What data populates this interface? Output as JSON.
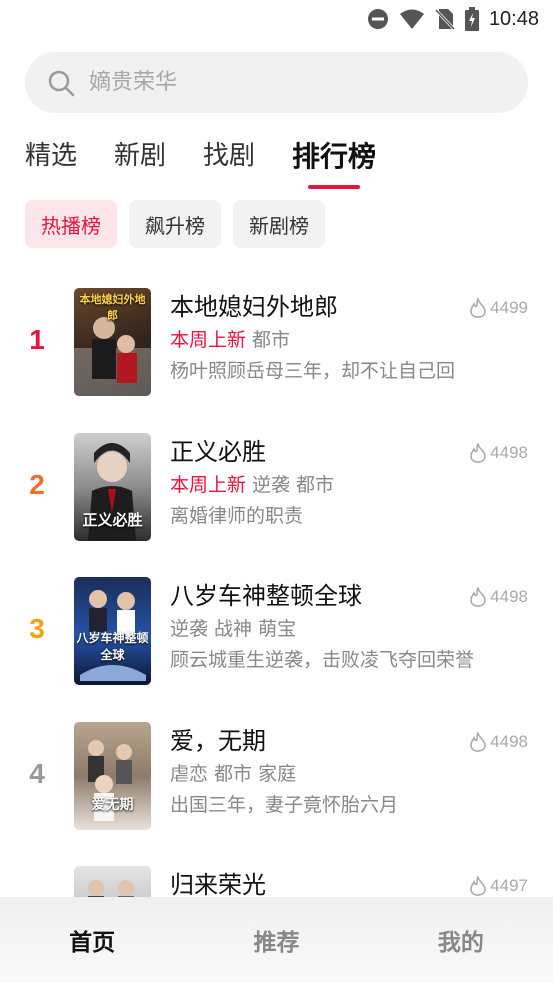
{
  "status_bar": {
    "time": "10:48"
  },
  "search": {
    "placeholder": "嫡贵荣华"
  },
  "tabs": [
    {
      "label": "精选"
    },
    {
      "label": "新剧"
    },
    {
      "label": "找剧"
    },
    {
      "label": "排行榜"
    }
  ],
  "chips": [
    {
      "label": "热播榜"
    },
    {
      "label": "飙升榜"
    },
    {
      "label": "新剧榜"
    }
  ],
  "list": [
    {
      "rank": "1",
      "rank_color": "#e8133f",
      "title": "本地媳妇外地郎",
      "new_tag": "本周上新",
      "tags": "都市",
      "desc": "杨叶照顾岳母三年，却不让自己回",
      "heat": "4499",
      "poster_text": "本地媳妇外地郎"
    },
    {
      "rank": "2",
      "rank_color": "#f26a2e",
      "title": "正义必胜",
      "new_tag": "本周上新",
      "tags": "逆袭 都市",
      "desc": "离婚律师的职责",
      "heat": "4498",
      "poster_text": "正义必胜"
    },
    {
      "rank": "3",
      "rank_color": "#f5a10a",
      "title": "八岁车神整顿全球",
      "new_tag": "",
      "tags": "逆袭 战神 萌宝",
      "desc": "顾云城重生逆袭，击败凌飞夺回荣誉",
      "heat": "4498",
      "poster_text": "八岁车神整顿全球"
    },
    {
      "rank": "4",
      "rank_color": "#999999",
      "title": "爱，无期",
      "new_tag": "",
      "tags": "虐恋 都市 家庭",
      "desc": "出国三年，妻子竟怀胎六月",
      "heat": "4498",
      "poster_text": "爱无期"
    },
    {
      "rank": "",
      "rank_color": "#999999",
      "title": "归来荣光",
      "new_tag": "",
      "tags": "",
      "desc": "",
      "heat": "4497",
      "poster_text": ""
    }
  ],
  "bottom_nav": [
    {
      "label": "首页"
    },
    {
      "label": "推荐"
    },
    {
      "label": "我的"
    }
  ]
}
